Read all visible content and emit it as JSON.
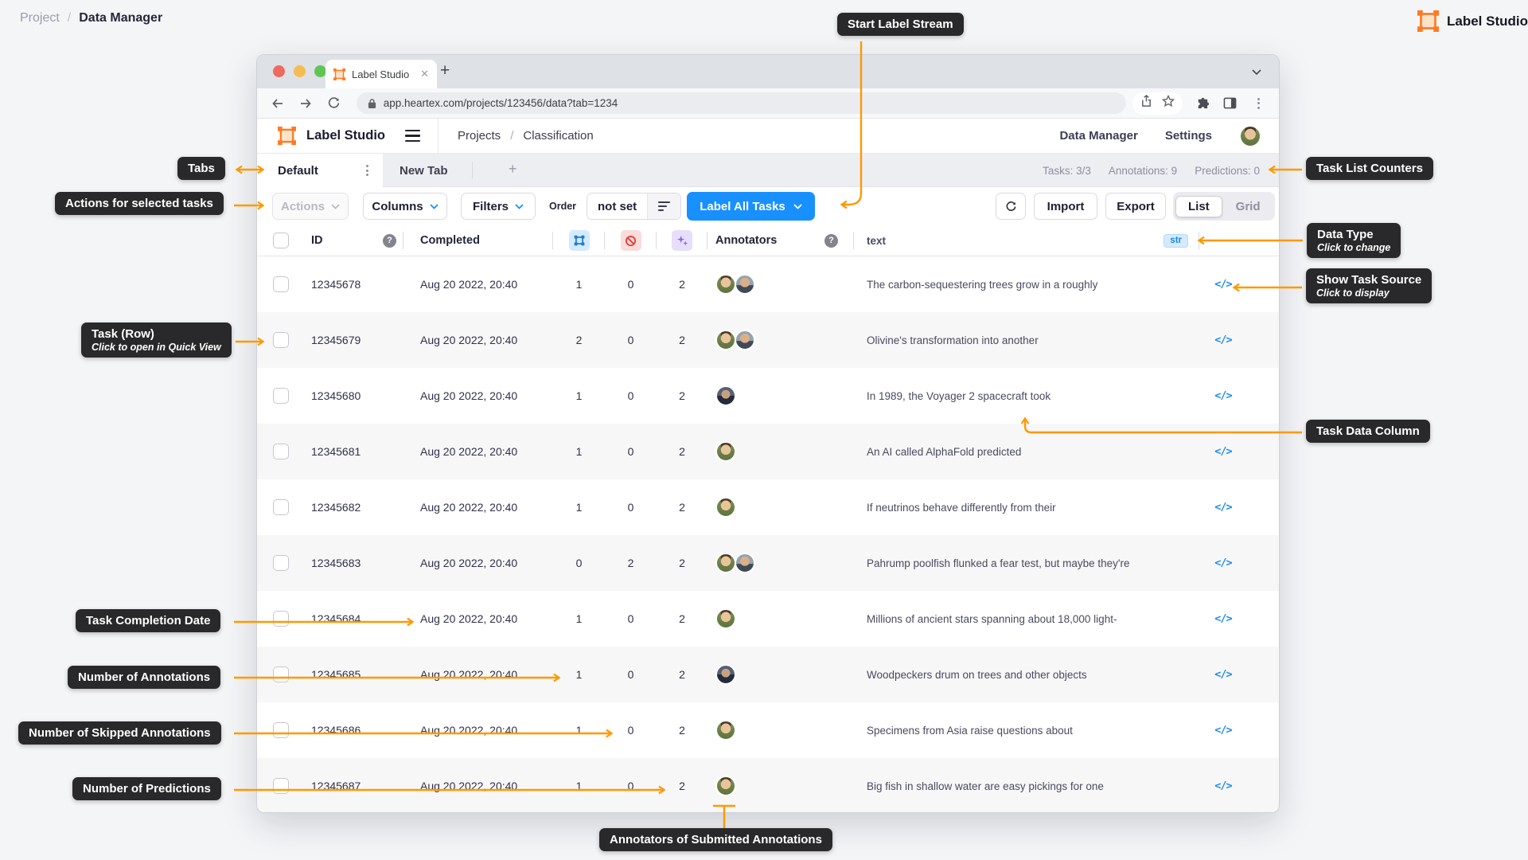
{
  "page": {
    "breadcrumb": {
      "root": "Project",
      "separator": "/",
      "current": "Data Manager"
    },
    "brand": {
      "name": "Label Studio"
    }
  },
  "browser": {
    "tab_title": "Label Studio",
    "new_tab_plus": "+",
    "url": "app.heartex.com/projects/123456/data?tab=1234"
  },
  "app_header": {
    "logo_text": "Label Studio",
    "breadcrumb": {
      "root": "Projects",
      "separator": "/",
      "current": "Classification"
    },
    "nav": {
      "data_manager": "Data Manager",
      "settings": "Settings"
    }
  },
  "tabs_row": {
    "active_tab": "Default",
    "second_tab": "New Tab",
    "add_tab": "+",
    "counters": [
      "Tasks: 3/3",
      "Annotations: 9",
      "Predictions: 0"
    ]
  },
  "toolbar": {
    "actions": "Actions",
    "columns": "Columns",
    "filters": "Filters",
    "order_label": "Order",
    "order_value": "not set",
    "label_all_tasks": "Label All Tasks",
    "import": "Import",
    "export": "Export",
    "view_list": "List",
    "view_grid": "Grid"
  },
  "table": {
    "headers": {
      "id": "ID",
      "completed": "Completed",
      "annotators": "Annotators",
      "text": "text"
    },
    "data_type_badge": "str",
    "show_source_icon": "</>",
    "rows": [
      {
        "id": "12345678",
        "completed": "Aug 20 2022, 20:40",
        "annotations": "1",
        "skipped": "0",
        "predictions": "2",
        "annotators": [
          "w",
          "m"
        ],
        "text": "The carbon-sequestering trees grow in a roughly"
      },
      {
        "id": "12345679",
        "completed": "Aug 20 2022, 20:40",
        "annotations": "2",
        "skipped": "0",
        "predictions": "2",
        "annotators": [
          "w",
          "m"
        ],
        "text": "Olivine's transformation into another"
      },
      {
        "id": "12345680",
        "completed": "Aug 20 2022, 20:40",
        "annotations": "1",
        "skipped": "0",
        "predictions": "2",
        "annotators": [
          "m2"
        ],
        "text": "In 1989, the Voyager 2 spacecraft took"
      },
      {
        "id": "12345681",
        "completed": "Aug 20 2022, 20:40",
        "annotations": "1",
        "skipped": "0",
        "predictions": "2",
        "annotators": [
          "w"
        ],
        "text": "An AI called AlphaFold predicted"
      },
      {
        "id": "12345682",
        "completed": "Aug 20 2022, 20:40",
        "annotations": "1",
        "skipped": "0",
        "predictions": "2",
        "annotators": [
          "w"
        ],
        "text": "If neutrinos behave differently from their"
      },
      {
        "id": "12345683",
        "completed": "Aug 20 2022, 20:40",
        "annotations": "0",
        "skipped": "2",
        "predictions": "2",
        "annotators": [
          "w",
          "m"
        ],
        "text": "Pahrump poolfish flunked a fear test, but maybe they're"
      },
      {
        "id": "12345684",
        "completed": "Aug 20 2022, 20:40",
        "annotations": "1",
        "skipped": "0",
        "predictions": "2",
        "annotators": [
          "w"
        ],
        "text": "Millions of ancient stars spanning about 18,000 light-"
      },
      {
        "id": "12345685",
        "completed": "Aug 20 2022, 20:40",
        "annotations": "1",
        "skipped": "0",
        "predictions": "2",
        "annotators": [
          "m2"
        ],
        "text": "Woodpeckers drum on trees and other objects"
      },
      {
        "id": "12345686",
        "completed": "Aug 20 2022, 20:40",
        "annotations": "1",
        "skipped": "0",
        "predictions": "2",
        "annotators": [
          "w"
        ],
        "text": "Specimens from Asia raise questions about"
      },
      {
        "id": "12345687",
        "completed": "Aug 20 2022, 20:40",
        "annotations": "1",
        "skipped": "0",
        "predictions": "2",
        "annotators": [
          "w"
        ],
        "text": "Big fish in shallow water are easy pickings for one"
      }
    ]
  },
  "callouts": {
    "start_label_stream": {
      "label": "Start Label Stream"
    },
    "tabs": {
      "label": "Tabs"
    },
    "task_list_counters": {
      "label": "Task List Counters"
    },
    "actions_for_selected": {
      "label": "Actions for selected tasks"
    },
    "data_type": {
      "label": "Data Type",
      "sublabel": "Click to change"
    },
    "show_task_source": {
      "label": "Show Task Source",
      "sublabel": "Click to display"
    },
    "task_row": {
      "label": "Task (Row)",
      "sublabel": "Click to open in Quick View"
    },
    "task_data_column": {
      "label": "Task Data Column"
    },
    "task_completion_date": {
      "label": "Task Completion Date"
    },
    "number_of_annotations": {
      "label": "Number of Annotations"
    },
    "number_of_skipped_annotations": {
      "label": "Number of Skipped Annotations"
    },
    "number_of_predictions": {
      "label": "Number of Predictions"
    },
    "annotators_of_submitted": {
      "label": "Annotators of Submitted Annotations"
    }
  },
  "colors": {
    "accent_orange": "#FF9800",
    "logo_orange": "#FF7B21",
    "primary_blue": "#1890FF",
    "callout_background": "#29292B",
    "skip_red": "#E0403D",
    "prediction_purple": "#8B63F4"
  }
}
